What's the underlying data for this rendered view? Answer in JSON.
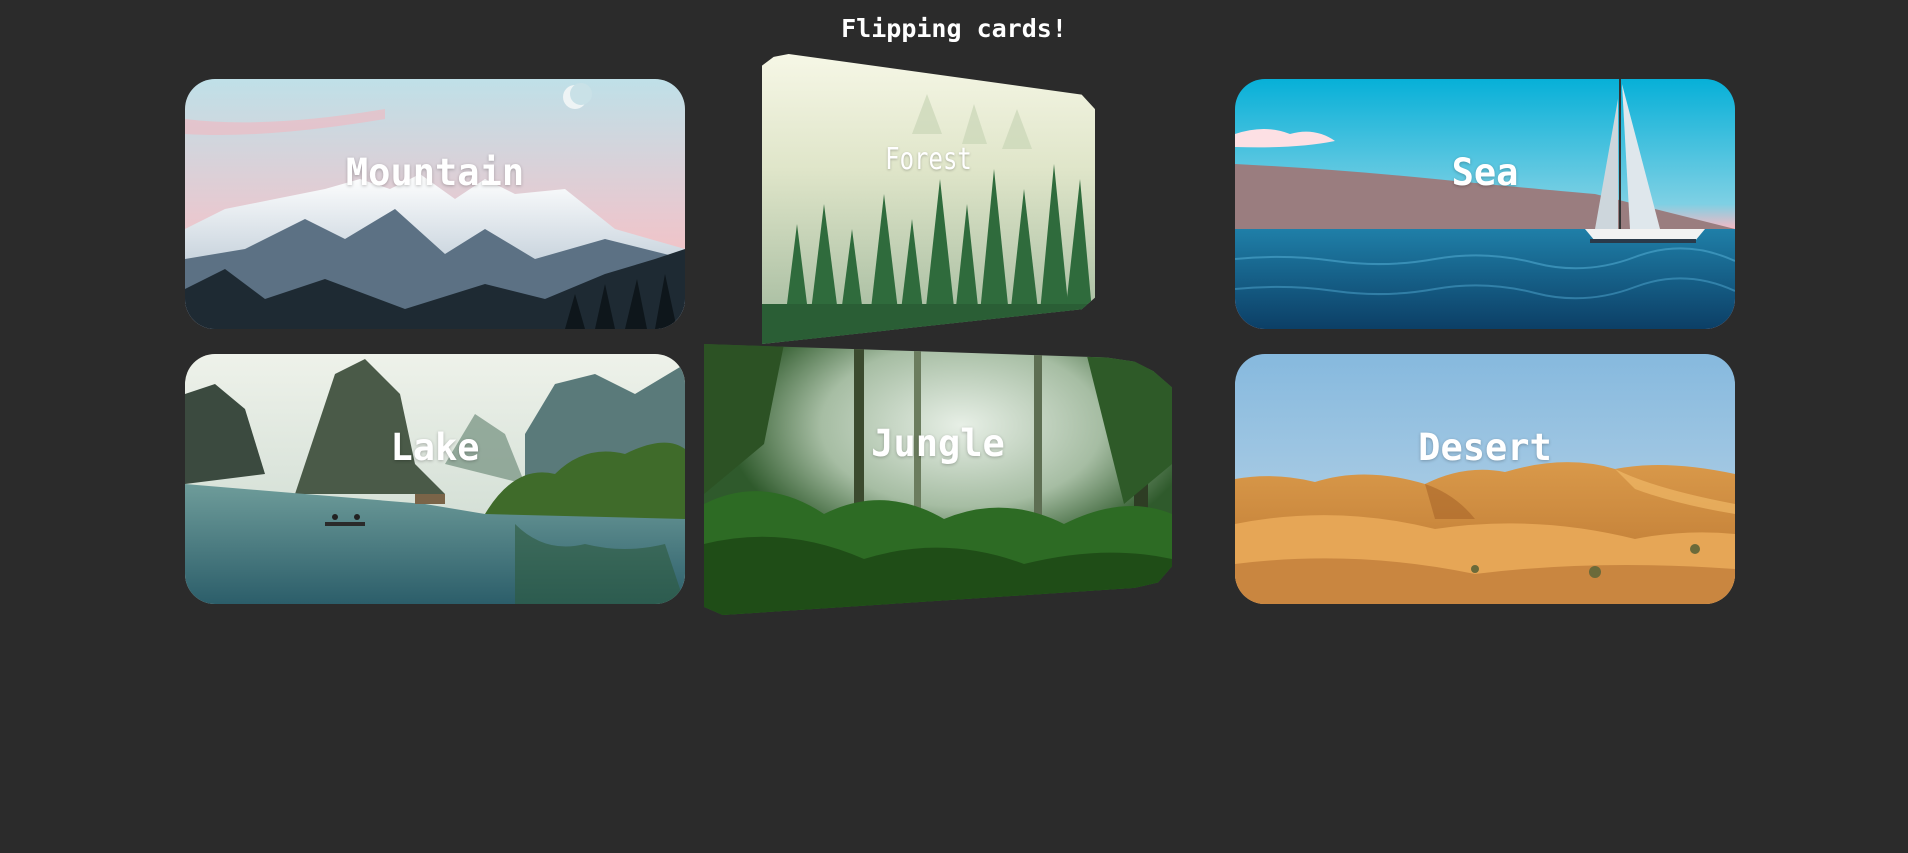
{
  "page": {
    "title": "Flipping cards!"
  },
  "cards": [
    {
      "id": "mountain",
      "label": "Mountain"
    },
    {
      "id": "forest",
      "label": "Forest"
    },
    {
      "id": "sea",
      "label": "Sea"
    },
    {
      "id": "lake",
      "label": "Lake"
    },
    {
      "id": "jungle",
      "label": "Jungle"
    },
    {
      "id": "desert",
      "label": "Desert"
    }
  ],
  "colors": {
    "background": "#2b2b2b",
    "text": "#ffffff"
  }
}
